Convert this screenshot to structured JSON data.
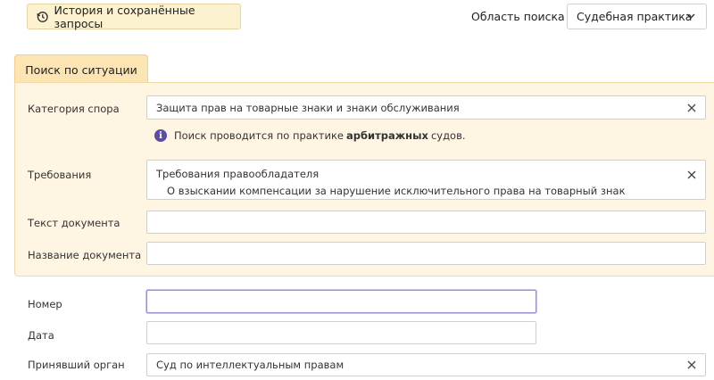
{
  "header": {
    "history_button_label": "История и сохранённые запросы",
    "scope_label": "Область поиска",
    "scope_value": "Судебная практика"
  },
  "tab": {
    "label": "Поиск по ситуации"
  },
  "situation": {
    "category": {
      "label": "Категория спора",
      "value": "Защита прав на товарные знаки и знаки обслуживания"
    },
    "notice": {
      "prefix": "Поиск проводится по практике",
      "bold": "арбитражных",
      "suffix": "судов."
    },
    "requirements": {
      "label": "Требования",
      "value_group": "Требования правообладателя",
      "value_item": "О взыскании компенсации за нарушение исключительного права на товарный знак"
    },
    "document_text": {
      "label": "Текст документа",
      "value": ""
    },
    "document_name": {
      "label": "Название документа",
      "value": ""
    }
  },
  "attributes": {
    "number": {
      "label": "Номер",
      "value": ""
    },
    "date": {
      "label": "Дата",
      "value": ""
    },
    "authority": {
      "label": "Принявший орган",
      "value": "Суд по интеллектуальным правам"
    }
  },
  "colors": {
    "tab_bg": "#fce5b2",
    "panel_bg": "#fef6e3",
    "button_bg": "#fdf2cf",
    "info_icon": "#5b4fa3"
  },
  "icons": [
    "clock-icon",
    "chevron-down-icon",
    "close-icon",
    "info-icon"
  ]
}
